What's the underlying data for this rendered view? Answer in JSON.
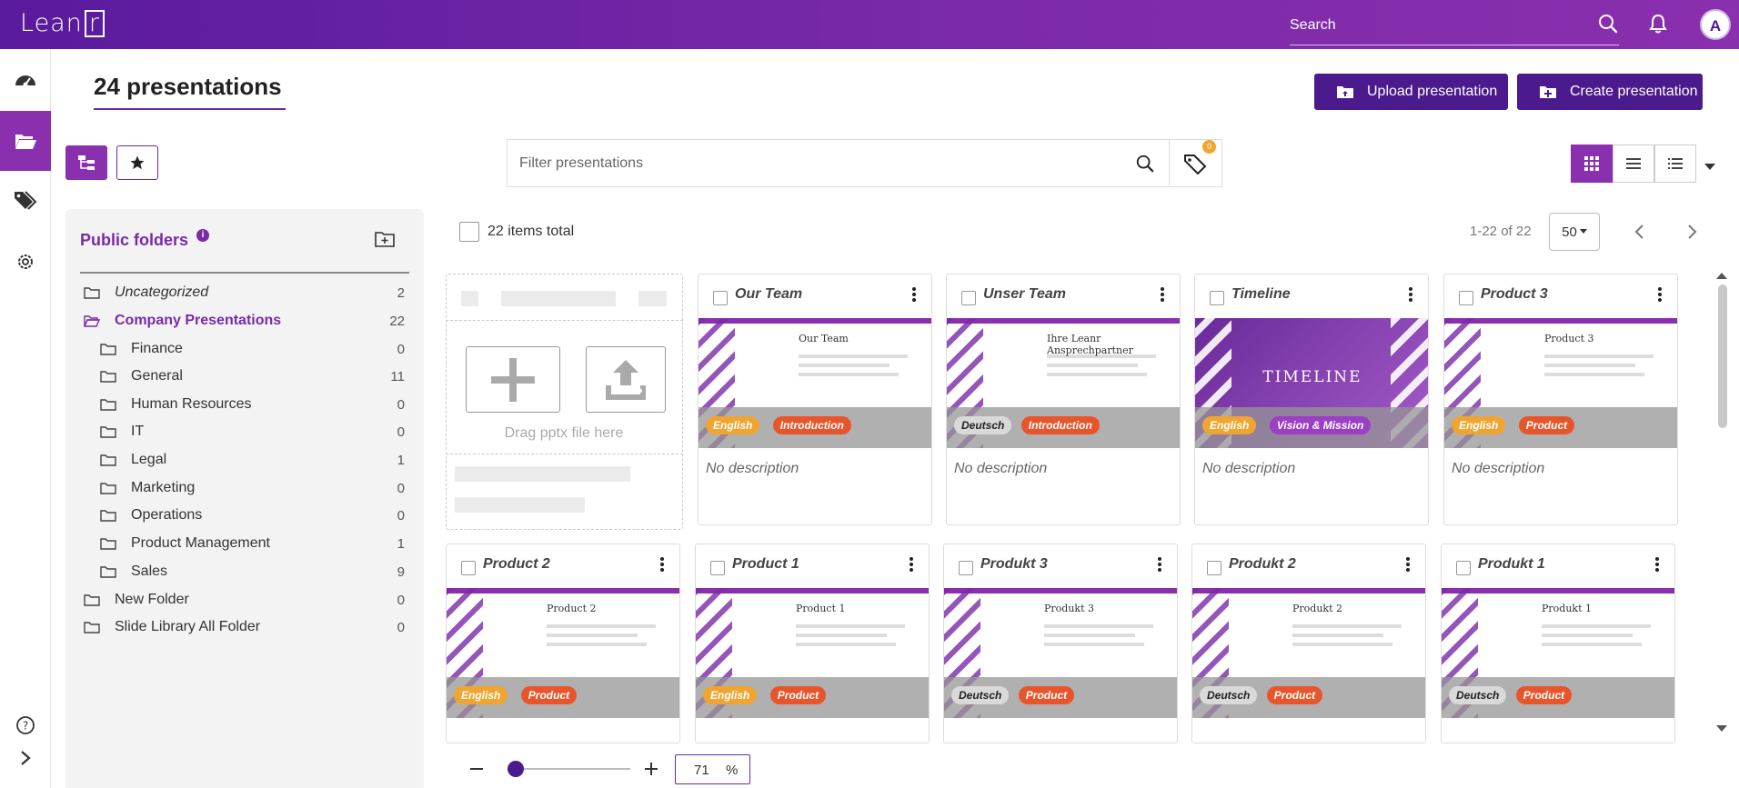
{
  "app": {
    "logo_text": "Lean",
    "logo_box": "r",
    "avatar_letter": "A",
    "search_placeholder": "Search"
  },
  "page": {
    "title": "24 presentations"
  },
  "actions": {
    "upload_label": "Upload presentation",
    "create_label": "Create presentation"
  },
  "filter": {
    "placeholder": "Filter presentations",
    "tag_count": "0"
  },
  "sidebar": {
    "title": "Public folders",
    "folders": [
      {
        "name": "Uncategorized",
        "count": "2",
        "italic": true
      },
      {
        "name": "Company Presentations",
        "count": "22",
        "open": true
      },
      {
        "name": "Finance",
        "count": "0"
      },
      {
        "name": "General",
        "count": "11"
      },
      {
        "name": "Human Resources",
        "count": "0"
      },
      {
        "name": "IT",
        "count": "0"
      },
      {
        "name": "Legal",
        "count": "1"
      },
      {
        "name": "Marketing",
        "count": "0"
      },
      {
        "name": "Operations",
        "count": "0"
      },
      {
        "name": "Product Management",
        "count": "1"
      },
      {
        "name": "Sales",
        "count": "9"
      },
      {
        "name": "New Folder",
        "count": "0"
      },
      {
        "name": "Slide Library All Folder",
        "count": "0"
      }
    ]
  },
  "list": {
    "items_total": "22 items total",
    "range": "1-22 of 22",
    "per_page": "50"
  },
  "dropzone": {
    "text": "Drag pptx file here"
  },
  "cards": [
    {
      "title": "Our Team",
      "tags": [
        "English",
        "Introduction"
      ],
      "desc": "No description",
      "slide_title": "Our Team"
    },
    {
      "title": "Unser Team",
      "tags": [
        "Deutsch",
        "Introduction"
      ],
      "desc": "No description",
      "slide_title": "Ihre Leanr Ansprechpartner"
    },
    {
      "title": "Timeline",
      "tags": [
        "English",
        "Vision & Mission"
      ],
      "desc": "No description",
      "slide_title": "TIMELINE"
    },
    {
      "title": "Product 3",
      "tags": [
        "English",
        "Product"
      ],
      "desc": "No description",
      "slide_title": "Product 3"
    },
    {
      "title": "Product 2",
      "tags": [
        "English",
        "Product"
      ],
      "desc": "",
      "slide_title": "Product 2"
    },
    {
      "title": "Product 1",
      "tags": [
        "English",
        "Product"
      ],
      "desc": "",
      "slide_title": "Product 1"
    },
    {
      "title": "Produkt 3",
      "tags": [
        "Deutsch",
        "Product"
      ],
      "desc": "",
      "slide_title": "Produkt 3"
    },
    {
      "title": "Produkt 2",
      "tags": [
        "Deutsch",
        "Product"
      ],
      "desc": "",
      "slide_title": "Produkt 2"
    },
    {
      "title": "Produkt 1",
      "tags": [
        "Deutsch",
        "Product"
      ],
      "desc": "",
      "slide_title": "Produkt 1"
    }
  ],
  "zoom": {
    "value": "71",
    "unit": "%"
  },
  "colors": {
    "brand": "#4b1a8c",
    "accent": "#8a2fae",
    "tag_english": "#f0a530",
    "tag_deutsch": "#d9d9d9",
    "tag_introduction": "#e8552b",
    "tag_product": "#e8552b",
    "tag_vision": "#9b3fc4"
  }
}
